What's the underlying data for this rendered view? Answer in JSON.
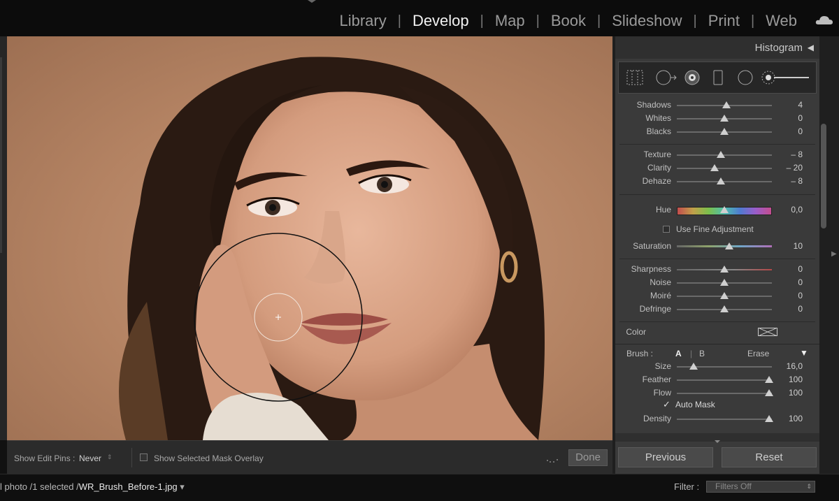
{
  "top_nav": {
    "modules": [
      {
        "label": "Library",
        "active": false
      },
      {
        "label": "Develop",
        "active": true
      },
      {
        "label": "Map",
        "active": false
      },
      {
        "label": "Book",
        "active": false
      },
      {
        "label": "Slideshow",
        "active": false
      },
      {
        "label": "Print",
        "active": false
      },
      {
        "label": "Web",
        "active": false
      }
    ],
    "separator": "|",
    "cloud_icon": "cloud-icon"
  },
  "photo_toolbar": {
    "show_edit_pins_label": "Show Edit Pins :",
    "show_edit_pins_value": "Never",
    "show_mask_overlay_label": "Show Selected Mask Overlay",
    "done_label": "Done"
  },
  "panel": {
    "histogram_label": "Histogram",
    "histogram_toggle": "◀",
    "tools": [
      "crop-overlay-icon",
      "spot-removal-icon",
      "red-eye-icon",
      "graduated-filter-icon",
      "radial-filter-icon",
      "adjustment-brush-icon"
    ],
    "tone": [
      {
        "name": "Shadows",
        "value": "4",
        "pos": 0.52
      },
      {
        "name": "Whites",
        "value": "0",
        "pos": 0.5
      },
      {
        "name": "Blacks",
        "value": "0",
        "pos": 0.5
      }
    ],
    "presence": [
      {
        "name": "Texture",
        "value": "– 8",
        "pos": 0.46
      },
      {
        "name": "Clarity",
        "value": "– 20",
        "pos": 0.4
      },
      {
        "name": "Dehaze",
        "value": "– 8",
        "pos": 0.46
      }
    ],
    "hue": {
      "name": "Hue",
      "value": "0,0",
      "pos": 0.5
    },
    "fine_adjustment_label": "Use Fine Adjustment",
    "saturation": {
      "name": "Saturation",
      "value": "10",
      "pos": 0.55
    },
    "detail": [
      {
        "name": "Sharpness",
        "value": "0",
        "pos": 0.5
      },
      {
        "name": "Noise",
        "value": "0",
        "pos": 0.5
      },
      {
        "name": "Moiré",
        "value": "0",
        "pos": 0.5
      },
      {
        "name": "Defringe",
        "value": "0",
        "pos": 0.5
      }
    ],
    "color_label": "Color",
    "brush": {
      "label": "Brush :",
      "a": "A",
      "b": "B",
      "erase": "Erase",
      "menu": "▼",
      "size": {
        "name": "Size",
        "value": "16,0",
        "pos": 0.18
      },
      "feather": {
        "name": "Feather",
        "value": "100",
        "pos": 0.97
      },
      "flow": {
        "name": "Flow",
        "value": "100",
        "pos": 0.97
      },
      "auto_mask_label": "Auto Mask",
      "auto_mask_checked": true,
      "density": {
        "name": "Density",
        "value": "100",
        "pos": 0.97
      }
    },
    "previous_label": "Previous",
    "reset_label": "Reset"
  },
  "filmstrip": {
    "info_prefix": "l photo /1 selected /",
    "filename": "WR_Brush_Before-1.jpg",
    "filename_arrow": "▾",
    "filter_label": "Filter :",
    "filter_value": "Filters Off"
  },
  "colors": {
    "active_module": "#f2f2f2",
    "inactive_module": "#9a9a9a",
    "panel_bg": "#3a3a3a",
    "app_bg": "#0c0c0c"
  }
}
